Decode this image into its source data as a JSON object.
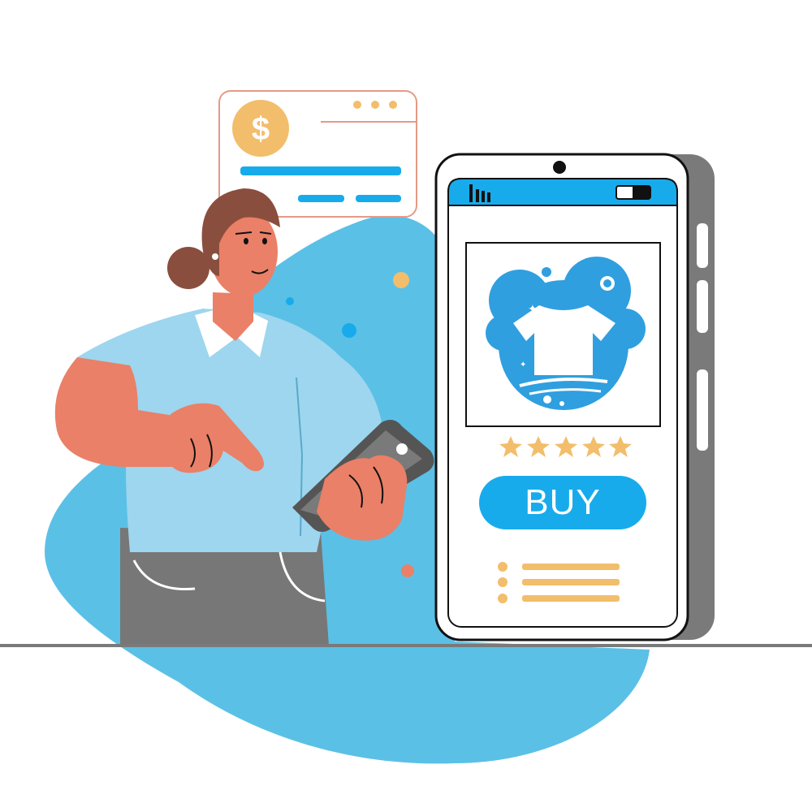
{
  "payment_card": {
    "currency_symbol": "$",
    "icon": "dollar-coin-icon",
    "menu_icon": "three-dots-icon"
  },
  "phone": {
    "status_bar": {
      "signal_icon": "signal-bars-icon",
      "battery_icon": "battery-icon"
    },
    "product": {
      "image_icon": "laundry-shirt-bubbles-icon"
    },
    "rating": {
      "value": 5,
      "max": 5,
      "icon": "star-icon"
    },
    "buy_button": {
      "label": "BUY"
    },
    "details_list": {
      "items": 3
    }
  },
  "colors": {
    "accent_blue": "#18ABEC",
    "blob_blue": "#5BC0E6",
    "star_gold": "#F2BE6B",
    "skin": "#EA8067",
    "hair": "#8A4E3E",
    "shirt": "#9DD6EE",
    "grey": "#777777"
  }
}
